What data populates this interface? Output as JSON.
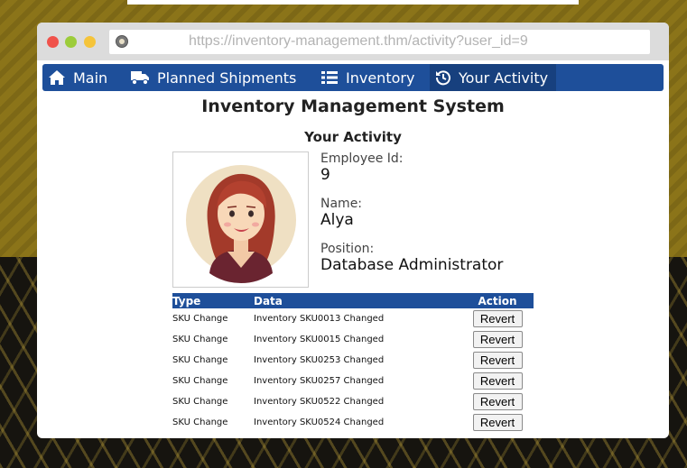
{
  "browser": {
    "url": "https://inventory-management.thm/activity?user_id=9"
  },
  "nav": {
    "items": [
      {
        "label": "Main",
        "icon": "home-icon"
      },
      {
        "label": "Planned Shipments",
        "icon": "truck-icon"
      },
      {
        "label": "Inventory",
        "icon": "list-icon"
      },
      {
        "label": "Your Activity",
        "icon": "history-icon",
        "active": true
      }
    ]
  },
  "page": {
    "title": "Inventory Management System",
    "subtitle": "Your Activity"
  },
  "employee": {
    "id_label": "Employee Id:",
    "id_value": "9",
    "name_label": "Name:",
    "name_value": "Alya",
    "position_label": "Position:",
    "position_value": "Database Administrator"
  },
  "table": {
    "headers": {
      "type": "Type",
      "data": "Data",
      "action": "Action"
    },
    "rows": [
      {
        "type": "SKU Change",
        "data": "Inventory SKU0013 Changed",
        "action": "Revert"
      },
      {
        "type": "SKU Change",
        "data": "Inventory SKU0015 Changed",
        "action": "Revert"
      },
      {
        "type": "SKU Change",
        "data": "Inventory SKU0253 Changed",
        "action": "Revert"
      },
      {
        "type": "SKU Change",
        "data": "Inventory SKU0257 Changed",
        "action": "Revert"
      },
      {
        "type": "SKU Change",
        "data": "Inventory SKU0522 Changed",
        "action": "Revert"
      },
      {
        "type": "SKU Change",
        "data": "Inventory SKU0524 Changed",
        "action": "Revert"
      }
    ]
  },
  "colors": {
    "nav_bg": "#1e4f9a",
    "nav_active_bg": "#17407e",
    "background_gold": "#8b7419"
  }
}
